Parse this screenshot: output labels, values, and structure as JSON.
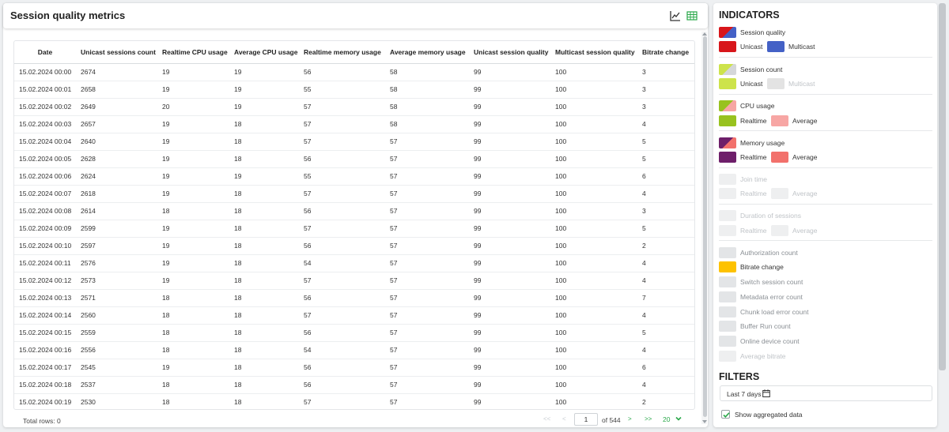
{
  "header": {
    "title": "Session quality metrics",
    "chart_icon": "line-chart-icon",
    "table_icon": "table-icon"
  },
  "table": {
    "columns": [
      "Date",
      "Unicast sessions count",
      "Realtime CPU usage",
      "Average CPU usage",
      "Realtime memory usage",
      "Average memory usage",
      "Unicast session quality",
      "Multicast session quality",
      "Bitrate change"
    ],
    "rows": [
      [
        "15.02.2024 00:00",
        "2674",
        "19",
        "19",
        "56",
        "58",
        "99",
        "100",
        "3"
      ],
      [
        "15.02.2024 00:01",
        "2658",
        "19",
        "19",
        "55",
        "58",
        "99",
        "100",
        "3"
      ],
      [
        "15.02.2024 00:02",
        "2649",
        "20",
        "19",
        "57",
        "58",
        "99",
        "100",
        "3"
      ],
      [
        "15.02.2024 00:03",
        "2657",
        "19",
        "18",
        "57",
        "58",
        "99",
        "100",
        "4"
      ],
      [
        "15.02.2024 00:04",
        "2640",
        "19",
        "18",
        "57",
        "57",
        "99",
        "100",
        "5"
      ],
      [
        "15.02.2024 00:05",
        "2628",
        "19",
        "18",
        "56",
        "57",
        "99",
        "100",
        "5"
      ],
      [
        "15.02.2024 00:06",
        "2624",
        "19",
        "19",
        "55",
        "57",
        "99",
        "100",
        "6"
      ],
      [
        "15.02.2024 00:07",
        "2618",
        "19",
        "18",
        "57",
        "57",
        "99",
        "100",
        "4"
      ],
      [
        "15.02.2024 00:08",
        "2614",
        "18",
        "18",
        "56",
        "57",
        "99",
        "100",
        "3"
      ],
      [
        "15.02.2024 00:09",
        "2599",
        "19",
        "18",
        "57",
        "57",
        "99",
        "100",
        "5"
      ],
      [
        "15.02.2024 00:10",
        "2597",
        "19",
        "18",
        "56",
        "57",
        "99",
        "100",
        "2"
      ],
      [
        "15.02.2024 00:11",
        "2576",
        "19",
        "18",
        "54",
        "57",
        "99",
        "100",
        "4"
      ],
      [
        "15.02.2024 00:12",
        "2573",
        "19",
        "18",
        "57",
        "57",
        "99",
        "100",
        "4"
      ],
      [
        "15.02.2024 00:13",
        "2571",
        "18",
        "18",
        "56",
        "57",
        "99",
        "100",
        "7"
      ],
      [
        "15.02.2024 00:14",
        "2560",
        "18",
        "18",
        "57",
        "57",
        "99",
        "100",
        "4"
      ],
      [
        "15.02.2024 00:15",
        "2559",
        "18",
        "18",
        "56",
        "57",
        "99",
        "100",
        "5"
      ],
      [
        "15.02.2024 00:16",
        "2556",
        "18",
        "18",
        "54",
        "57",
        "99",
        "100",
        "4"
      ],
      [
        "15.02.2024 00:17",
        "2545",
        "19",
        "18",
        "56",
        "57",
        "99",
        "100",
        "6"
      ],
      [
        "15.02.2024 00:18",
        "2537",
        "18",
        "18",
        "56",
        "57",
        "99",
        "100",
        "4"
      ],
      [
        "15.02.2024 00:19",
        "2530",
        "18",
        "18",
        "57",
        "57",
        "99",
        "100",
        "2"
      ]
    ]
  },
  "footer": {
    "total_rows": "Total rows: 0",
    "first": "<<",
    "prev": "<",
    "page": "1",
    "of_pages": "of 544",
    "next": ">",
    "last": ">>",
    "page_size": "20"
  },
  "indicators": {
    "title": "INDICATORS",
    "session_quality": {
      "label": "Session quality",
      "unicast": "Unicast",
      "multicast": "Multicast",
      "unicast_color": "#d8161b",
      "multicast_color": "#4461c6"
    },
    "session_count": {
      "label": "Session count",
      "unicast": "Unicast",
      "multicast": "Multicast",
      "unicast_color": "#cde34b",
      "multicast_color": "#e3e3e3"
    },
    "cpu_usage": {
      "label": "CPU usage",
      "realtime": "Realtime",
      "average": "Average",
      "realtime_color": "#98c21f",
      "average_color": "#f7a6a4"
    },
    "memory_usage": {
      "label": "Memory usage",
      "realtime": "Realtime",
      "average": "Average",
      "realtime_color": "#6e1f6a",
      "average_color": "#f2716c"
    },
    "join_time": {
      "label": "Join time",
      "realtime": "Realtime",
      "average": "Average"
    },
    "duration_of_sessions": {
      "label": "Duration of sessions",
      "realtime": "Realtime",
      "average": "Average"
    },
    "authorization_count": "Authorization count",
    "bitrate_change": "Bitrate change",
    "bitrate_color": "#fdc200",
    "switch_session_count": "Switch session count",
    "metadata_error_count": "Metadata error count",
    "chunk_load_error_count": "Chunk load error count",
    "buffer_run_count": "Buffer Run count",
    "online_device_count": "Online device count",
    "average_bitrate": "Average bitrate"
  },
  "filters": {
    "title": "FILTERS",
    "range": "Last 7 days",
    "show_aggregated": "Show aggregated data",
    "show_aggregated_checked": true
  },
  "colors": {
    "accent": "#2aa84a",
    "inactive": "#e3e5e7"
  }
}
